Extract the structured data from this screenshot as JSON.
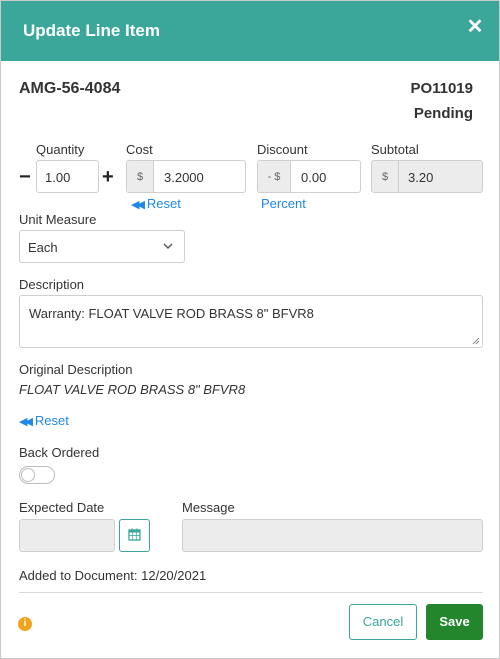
{
  "dialog": {
    "title": "Update Line Item",
    "close_icon": "close-icon",
    "header_color": "#3aa79a"
  },
  "item": {
    "number": "AMG-56-4084",
    "po_number": "PO11019",
    "po_status": "Pending"
  },
  "pricing": {
    "quantity_label": "Quantity",
    "quantity_value": "1.00",
    "decrement_symbol": "−",
    "increment_symbol": "+",
    "cost_label": "Cost",
    "cost_prefix": "$",
    "cost_value": "3.2000",
    "cost_reset": "Reset",
    "discount_label": "Discount",
    "discount_prefix": "- $",
    "discount_value": "0.00",
    "discount_toggle": "Percent",
    "subtotal_label": "Subtotal",
    "subtotal_prefix": "$",
    "subtotal_value": "3.20"
  },
  "unit_measure": {
    "label": "Unit Measure",
    "selected": "Each"
  },
  "description": {
    "label": "Description",
    "value": "Warranty: FLOAT VALVE ROD BRASS 8\" BFVR8"
  },
  "original_description": {
    "label": "Original Description",
    "value": "FLOAT VALVE ROD BRASS 8\" BFVR8",
    "reset": "Reset"
  },
  "back_ordered": {
    "label": "Back Ordered",
    "checked": false
  },
  "expected_date": {
    "label": "Expected Date",
    "value": ""
  },
  "message": {
    "label": "Message",
    "value": ""
  },
  "added_to_document": "Added to Document: 12/20/2021",
  "footer": {
    "info_icon": "info-icon",
    "cancel_label": "Cancel",
    "save_label": "Save",
    "save_color": "#23862c"
  }
}
